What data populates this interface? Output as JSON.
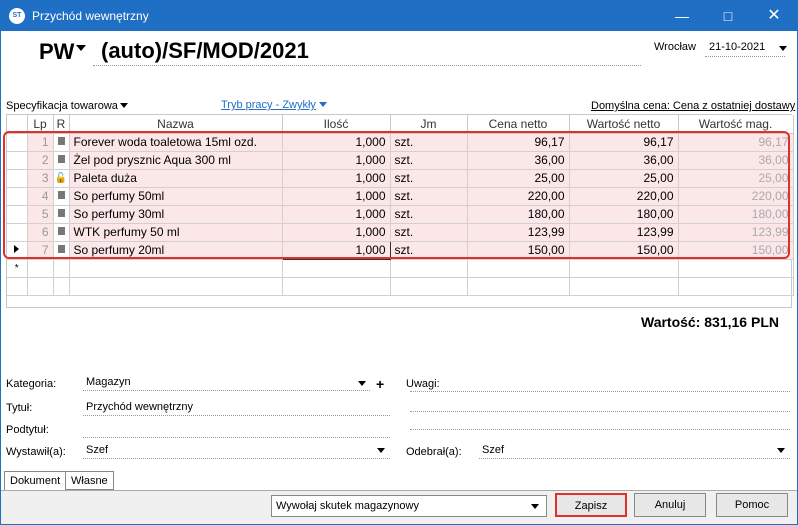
{
  "window": {
    "title": "Przychód wewnętrzny",
    "icon": "ST"
  },
  "document": {
    "prefix": "PW",
    "number": "(auto)/SF/MOD/2021",
    "place": "Wrocław",
    "date": "21-10-2021"
  },
  "toolbar": {
    "specification": "Specyfikacja towarowa",
    "work_mode": "Tryb pracy - Zwykły",
    "default_price": "Domyślna cena: Cena z ostatniej dostawy"
  },
  "grid": {
    "columns": [
      "Lp",
      "R",
      "Nazwa",
      "Ilość",
      "Jm",
      "Cena netto",
      "Wartość netto",
      "Wartość mag."
    ],
    "rows": [
      {
        "lp": "1",
        "r": "sq",
        "name": "Forever woda toaletowa 15ml ozd.",
        "qty": "1,000",
        "unit": "szt.",
        "price": "96,17",
        "value": "96,17",
        "mag": "96,17"
      },
      {
        "lp": "2",
        "r": "sq",
        "name": "Żel pod prysznic Aqua 300 ml",
        "qty": "1,000",
        "unit": "szt.",
        "price": "36,00",
        "value": "36,00",
        "mag": "36,00"
      },
      {
        "lp": "3",
        "r": "lock",
        "name": "Paleta duża",
        "qty": "1,000",
        "unit": "szt.",
        "price": "25,00",
        "value": "25,00",
        "mag": "25,00"
      },
      {
        "lp": "4",
        "r": "sq",
        "name": "So perfumy 50ml",
        "qty": "1,000",
        "unit": "szt.",
        "price": "220,00",
        "value": "220,00",
        "mag": "220,00"
      },
      {
        "lp": "5",
        "r": "sq",
        "name": "So perfumy 30ml",
        "qty": "1,000",
        "unit": "szt.",
        "price": "180,00",
        "value": "180,00",
        "mag": "180,00"
      },
      {
        "lp": "6",
        "r": "sq",
        "name": "WTK perfumy 50 ml",
        "qty": "1,000",
        "unit": "szt.",
        "price": "123,99",
        "value": "123,99",
        "mag": "123,99"
      },
      {
        "lp": "7",
        "r": "sq",
        "name": "So perfumy 20ml",
        "qty": "1,000",
        "unit": "szt.",
        "price": "150,00",
        "value": "150,00",
        "mag": "150,00"
      }
    ],
    "new_row_marker": "*"
  },
  "total": "Wartość: 831,16 PLN",
  "form": {
    "category_label": "Kategoria:",
    "category_value": "Magazyn",
    "title_label": "Tytuł:",
    "title_value": "Przychód wewnętrzny",
    "subtitle_label": "Podtytuł:",
    "subtitle_value": "",
    "issued_label": "Wystawił(a):",
    "issued_value": "Szef",
    "notes_label": "Uwagi:",
    "received_label": "Odebrał(a):",
    "received_value": "Szef",
    "plus": "+"
  },
  "tabs": [
    "Dokument",
    "Własne"
  ],
  "footer": {
    "action_select": "Wywołaj skutek magazynowy",
    "save": "Zapisz",
    "cancel": "Anuluj",
    "help": "Pomoc"
  },
  "colors": {
    "titlebar": "#1f6fc5",
    "highlight": "#e0302c",
    "row_bg": "#fbe6e8"
  }
}
